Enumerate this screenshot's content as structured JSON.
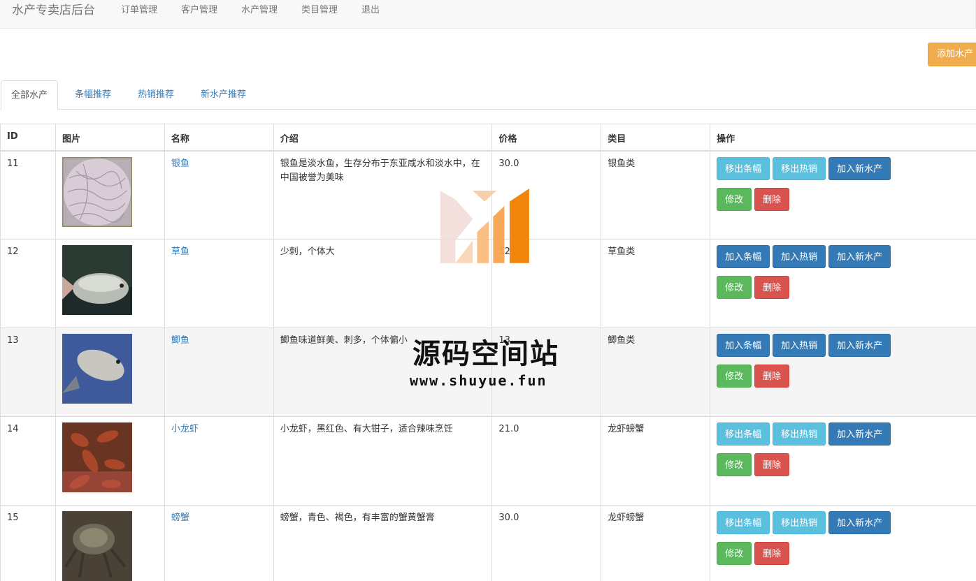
{
  "nav": {
    "brand": "水产专卖店后台",
    "items": [
      "订单管理",
      "客户管理",
      "水产管理",
      "类目管理",
      "退出"
    ]
  },
  "add_button": "添加水产",
  "tabs": [
    "全部水产",
    "条幅推荐",
    "热销推荐",
    "新水产推荐"
  ],
  "table": {
    "headers": [
      "ID",
      "图片",
      "名称",
      "介绍",
      "价格",
      "类目",
      "操作"
    ],
    "rows": [
      {
        "id": "11",
        "name": "银鱼",
        "intro": "银鱼是淡水鱼，生存分布于东亚咸水和淡水中，在中国被誉为美味",
        "price": "30.0",
        "category": "银鱼类",
        "banner_btn": "移出条幅",
        "hot_btn": "移出热销",
        "new_btn": "加入新水产",
        "edit_btn": "修改",
        "delete_btn": "删除"
      },
      {
        "id": "12",
        "name": "草鱼",
        "intro": "少刺，个体大",
        "price": "12",
        "category": "草鱼类",
        "banner_btn": "加入条幅",
        "hot_btn": "加入热销",
        "new_btn": "加入新水产",
        "edit_btn": "修改",
        "delete_btn": "删除"
      },
      {
        "id": "13",
        "name": "鲫鱼",
        "intro": "鲫鱼味道鲜美、刺多，个体偏小",
        "price": "13",
        "category": "鲫鱼类",
        "banner_btn": "加入条幅",
        "hot_btn": "加入热销",
        "new_btn": "加入新水产",
        "edit_btn": "修改",
        "delete_btn": "删除"
      },
      {
        "id": "14",
        "name": "小龙虾",
        "intro": "小龙虾，黑红色、有大钳子，适合辣味烹饪",
        "price": "21.0",
        "category": "龙虾螃蟹",
        "banner_btn": "移出条幅",
        "hot_btn": "移出热销",
        "new_btn": "加入新水产",
        "edit_btn": "修改",
        "delete_btn": "删除"
      },
      {
        "id": "15",
        "name": "螃蟹",
        "intro": "螃蟹，青色、褐色，有丰富的蟹黄蟹膏",
        "price": "30.0",
        "category": "龙虾螃蟹",
        "banner_btn": "移出条幅",
        "hot_btn": "移出热销",
        "new_btn": "加入新水产",
        "edit_btn": "修改",
        "delete_btn": "删除"
      }
    ]
  },
  "watermark": {
    "title": "源码空间站",
    "url": "www.shuyue.fun"
  },
  "colors": {
    "info": "#5bc0de",
    "primary": "#337ab7",
    "success": "#5cb85c",
    "danger": "#d9534f",
    "warning": "#f0ad4e"
  }
}
